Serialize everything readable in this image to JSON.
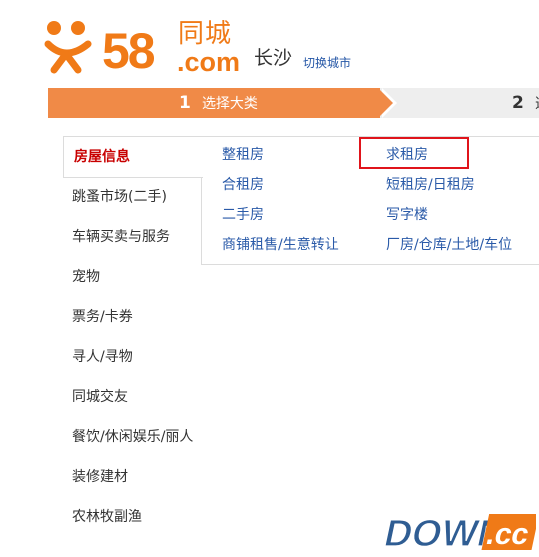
{
  "header": {
    "logo_number": "58",
    "logo_cn": "同城",
    "logo_com": ".com",
    "city": "长沙",
    "switch_city": "切换城市"
  },
  "steps": [
    {
      "num": "1",
      "label": "选择大类",
      "active": true
    },
    {
      "num": "2",
      "label": "选",
      "active": false
    }
  ],
  "categories": [
    {
      "label": "房屋信息",
      "active": true
    },
    {
      "label": "跳蚤市场(二手)"
    },
    {
      "label": "车辆买卖与服务"
    },
    {
      "label": "宠物"
    },
    {
      "label": "票务/卡券"
    },
    {
      "label": "寻人/寻物"
    },
    {
      "label": "同城交友"
    },
    {
      "label": "餐饮/休闲娱乐/丽人"
    },
    {
      "label": "装修建材"
    },
    {
      "label": "农林牧副渔"
    }
  ],
  "subcategories": [
    [
      "整租房",
      "求租房"
    ],
    [
      "合租房",
      "短租房/日租房"
    ],
    [
      "二手房",
      "写字楼"
    ],
    [
      "商铺租售/生意转让",
      "厂房/仓库/土地/车位"
    ]
  ],
  "highlighted": "求租房",
  "watermark": {
    "main": "DOWN",
    "suffix": ".cc"
  },
  "colors": {
    "brand": "#f07a17",
    "step_active": "#f08a47",
    "link": "#2a5aa8",
    "active_red": "#c80000",
    "highlight": "#e0141b"
  }
}
